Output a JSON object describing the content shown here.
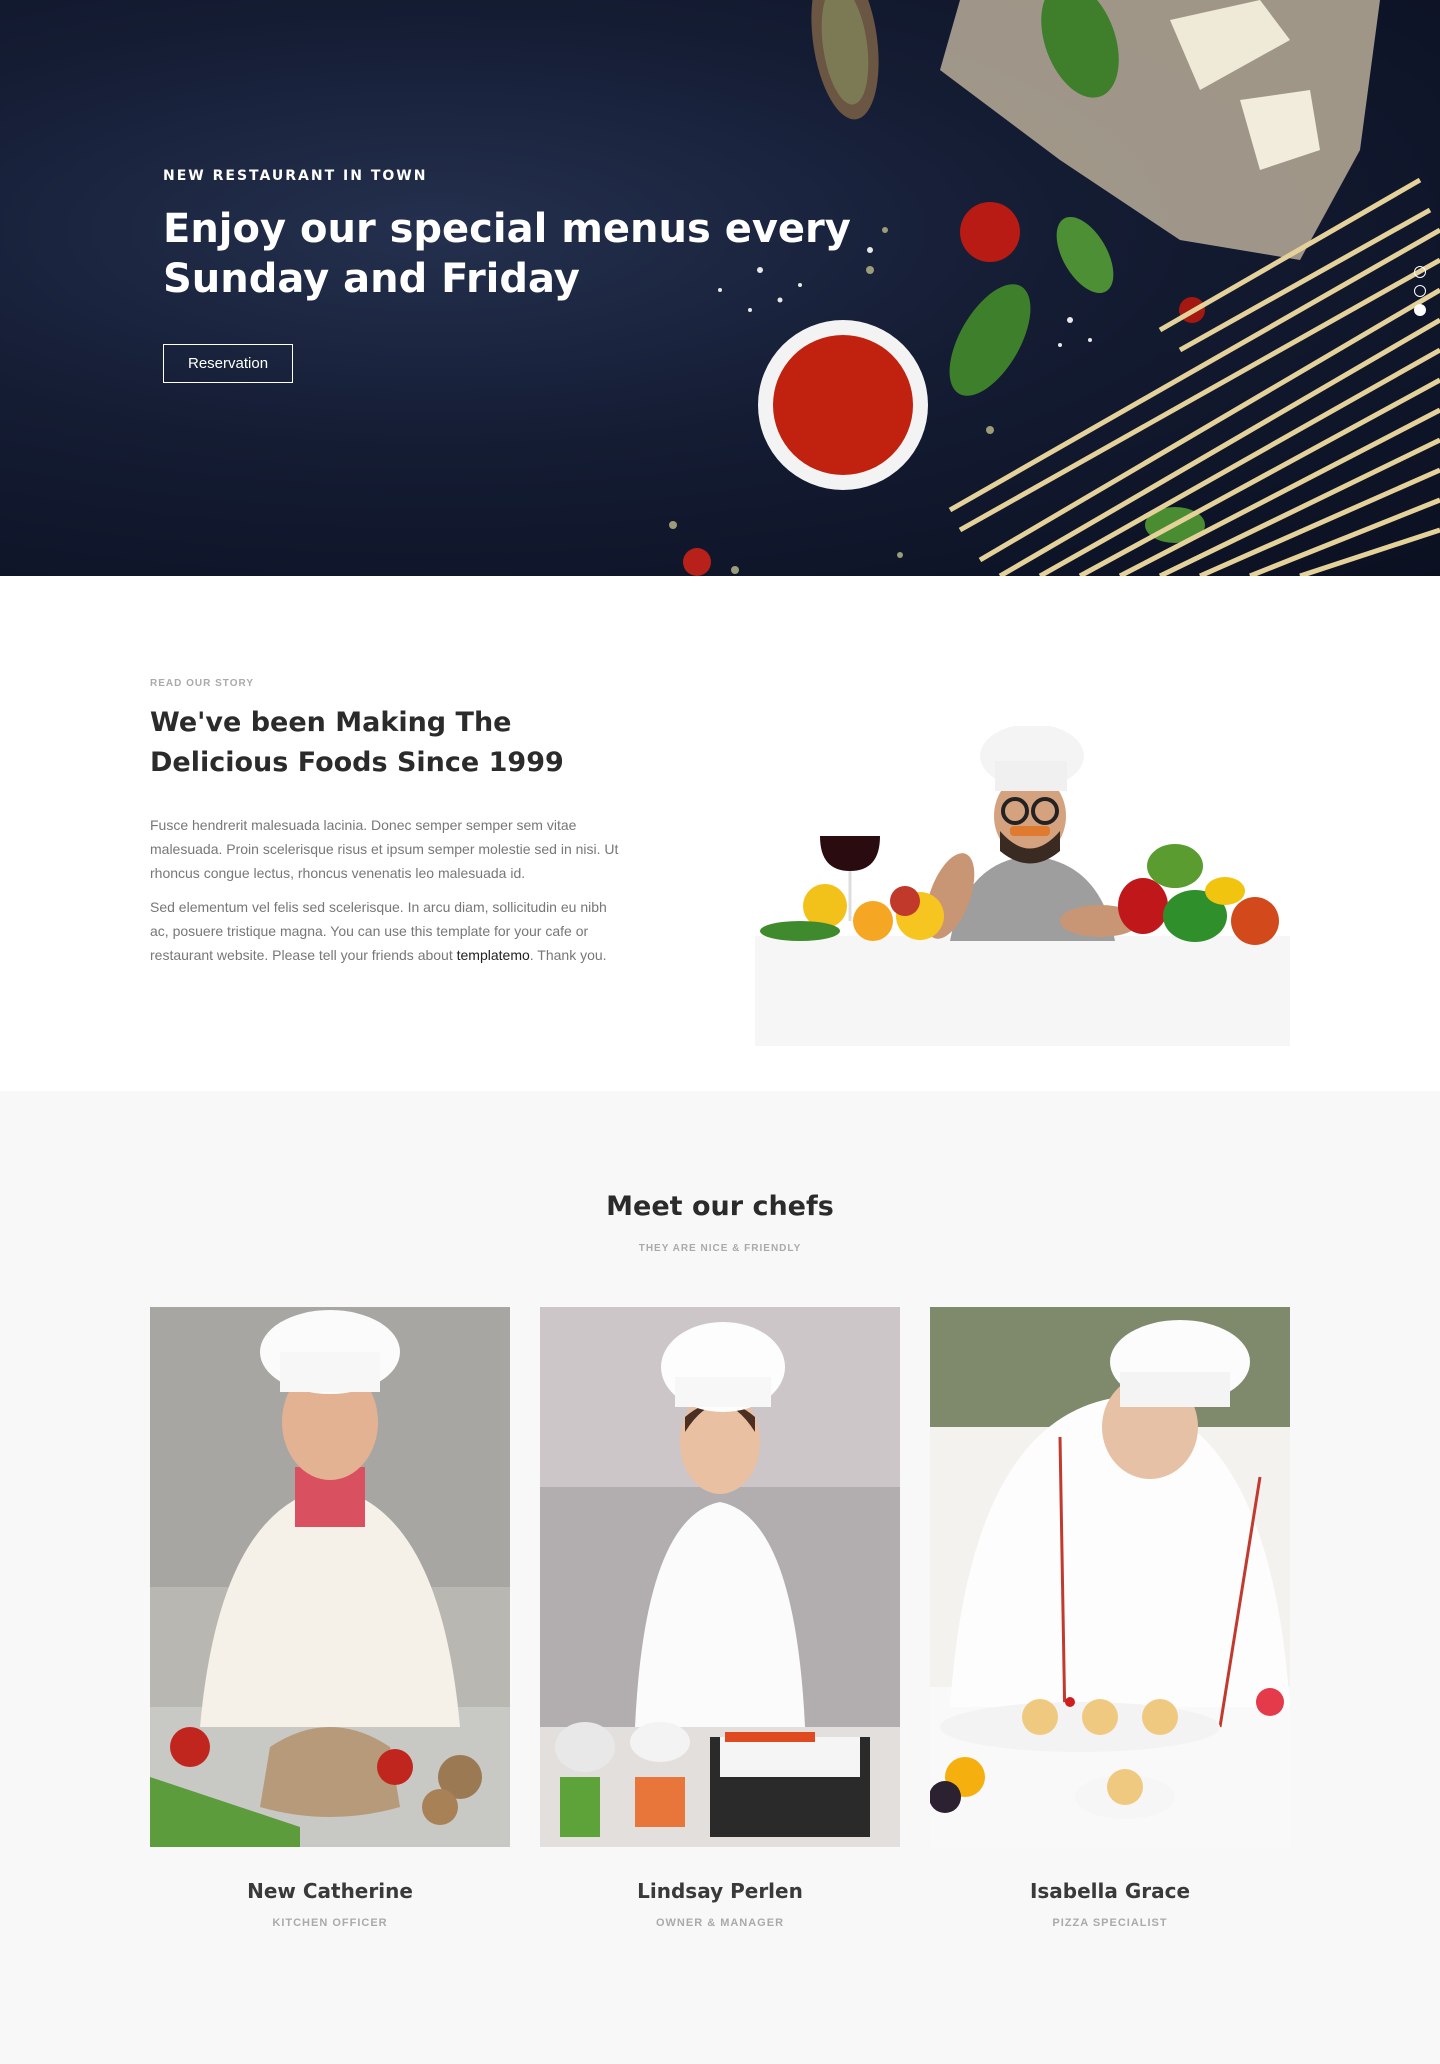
{
  "hero": {
    "subtitle": "NEW RESTAURANT IN TOWN",
    "title_line1": "Enjoy our special menus every",
    "title_line2": "Sunday and Friday",
    "button_label": "Reservation",
    "slider_count": 3,
    "active_slide": 3
  },
  "story": {
    "label": "READ OUR STORY",
    "title_line1": "We've been Making The",
    "title_line2": "Delicious Foods Since 1999",
    "paragraph1": "Fusce hendrerit malesuada lacinia. Donec semper semper sem vitae malesuada. Proin scelerisque risus et ipsum semper molestie sed in nisi. Ut rhoncus congue lectus, rhoncus venenatis leo malesuada id.",
    "paragraph2_before": "Sed elementum vel felis sed scelerisque. In arcu diam, sollicitudin eu nibh ac, posuere tristique magna. You can use this template for your cafe or restaurant website. Please tell your friends about ",
    "paragraph2_link": "templatemo",
    "paragraph2_after": ". Thank you."
  },
  "chefs": {
    "title": "Meet our chefs",
    "subtitle": "THEY ARE NICE & FRIENDLY",
    "items": [
      {
        "name": "New Catherine",
        "role": "KITCHEN OFFICER"
      },
      {
        "name": "Lindsay Perlen",
        "role": "OWNER & MANAGER"
      },
      {
        "name": "Isabella Grace",
        "role": "PIZZA SPECIALIST"
      }
    ]
  },
  "colors": {
    "hero_bg": "#141c33",
    "accent_white": "#ffffff",
    "section_bg": "#f8f8f8",
    "heading": "#2b2b2b",
    "muted": "#aaaaaa"
  }
}
